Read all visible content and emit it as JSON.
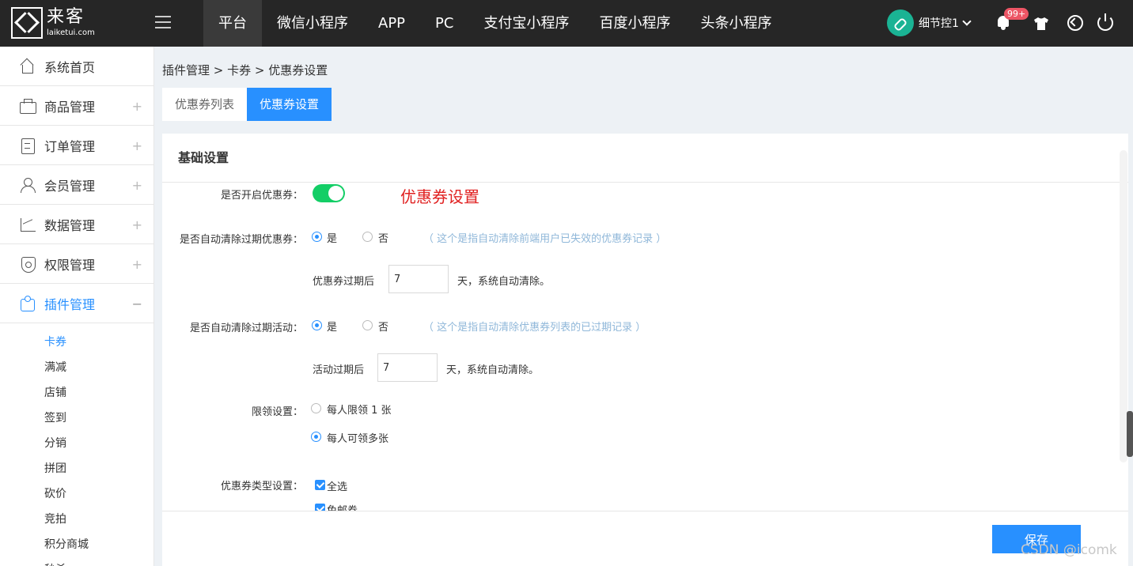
{
  "brand": {
    "name": "来客",
    "domain": "laiketui.com"
  },
  "topnav": {
    "items": [
      "平台",
      "微信小程序",
      "APP",
      "PC",
      "支付宝小程序",
      "百度小程序",
      "头条小程序"
    ]
  },
  "user": {
    "name": "细节控1",
    "badge": "99+"
  },
  "sidebar": {
    "items": [
      {
        "label": "系统首页"
      },
      {
        "label": "商品管理",
        "toggle": "+"
      },
      {
        "label": "订单管理",
        "toggle": "+"
      },
      {
        "label": "会员管理",
        "toggle": "+"
      },
      {
        "label": "数据管理",
        "toggle": "+"
      },
      {
        "label": "权限管理",
        "toggle": "+"
      },
      {
        "label": "插件管理",
        "toggle": "−"
      }
    ],
    "subitems": [
      "卡券",
      "满减",
      "店铺",
      "签到",
      "分销",
      "拼团",
      "砍价",
      "竞拍",
      "积分商城",
      "秒杀"
    ]
  },
  "breadcrumb": "插件管理 > 卡券 > 优惠券设置",
  "tabs": [
    "优惠券列表",
    "优惠券设置"
  ],
  "panel": {
    "title": "基础设置"
  },
  "form": {
    "enable_label": "是否开启优惠券：",
    "annotation": "优惠券设置",
    "auto_clear_coupon_label": "是否自动清除过期优惠券：",
    "yes": "是",
    "no": "否",
    "coupon_hint": "（ 这个是指自动清除前端用户已失效的优惠券记录 ）",
    "coupon_expire_prefix": "优惠券过期后",
    "coupon_expire_value": "7",
    "expire_suffix": "天，系统自动清除。",
    "auto_clear_activity_label": "是否自动清除过期活动：",
    "activity_hint": "（ 这个是指自动清除优惠券列表的已过期记录 ）",
    "activity_expire_prefix": "活动过期后",
    "activity_expire_value": "7",
    "limit_label": "限领设置：",
    "limit_one": "每人限领 1 张",
    "limit_multi": "每人可领多张",
    "type_label": "优惠券类型设置：",
    "type_all": "全选",
    "type_free_shipping": "免邮券"
  },
  "save_label": "保存",
  "watermark": "CSDN @icomk"
}
